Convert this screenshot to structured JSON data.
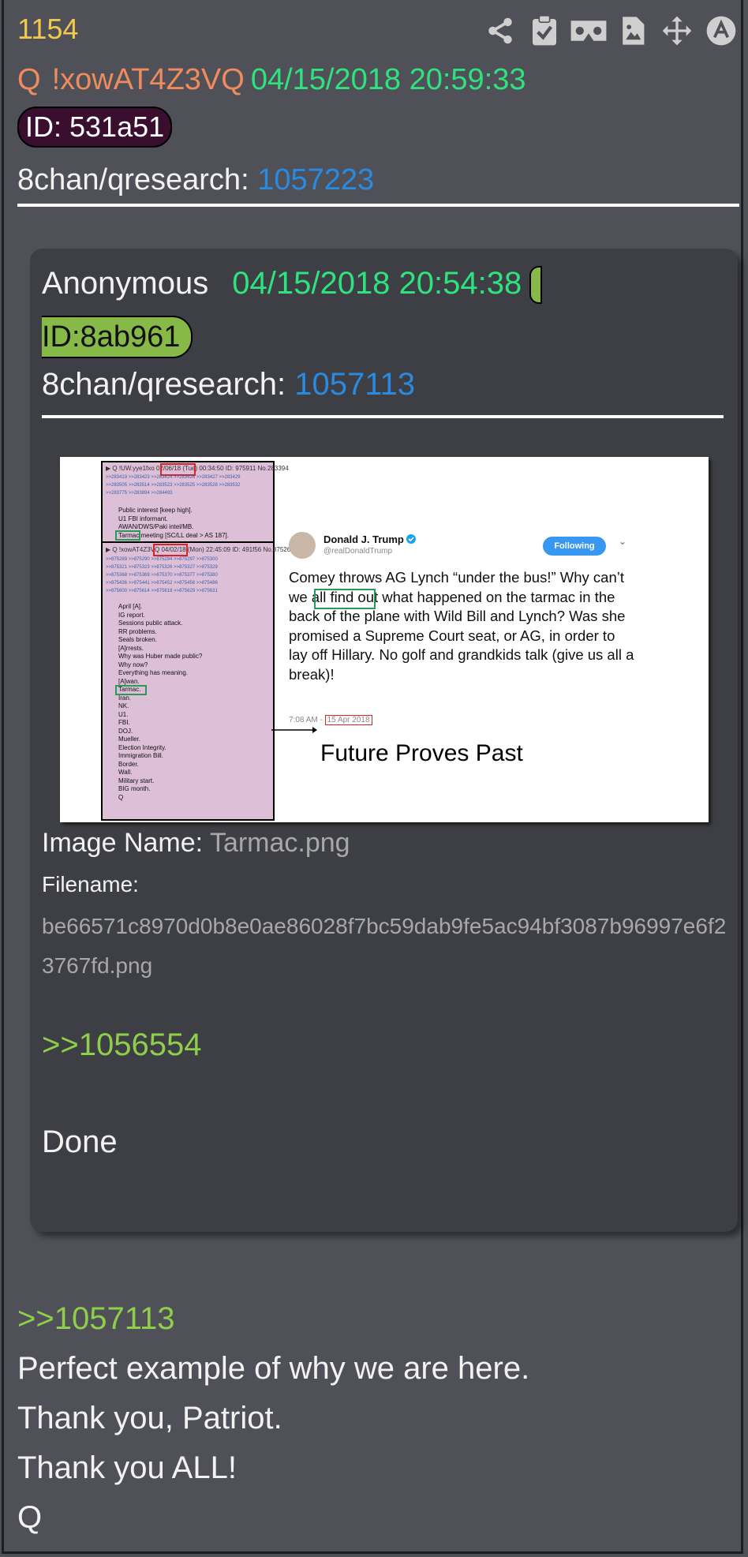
{
  "post": {
    "number": "1154",
    "author_letter": "Q",
    "tripcode": "!xowAT4Z3VQ",
    "datetime": "04/15/2018 20:59:33",
    "id_label": "ID: 531a51",
    "board": "8chan/qresearch:",
    "board_post": "1057223",
    "reply_ref": ">>1057113",
    "lines": [
      "Perfect example of why we are here.",
      "Thank you, Patriot.",
      "Thank you ALL!",
      "Q"
    ]
  },
  "toolbar_icons": [
    "share-icon",
    "clipboard-check-icon",
    "vr-goggles-icon",
    "image-file-icon",
    "move-arrows-icon",
    "circle-up-icon"
  ],
  "quoted": {
    "author": "Anonymous",
    "datetime": "04/15/2018 20:54:38",
    "id_label": "ID:8ab961",
    "board": "8chan/qresearch:",
    "board_post": "1057113",
    "image_name_label": "Image Name:",
    "image_name": "Tarmac.png",
    "filename_label": "Filename:",
    "filename": "be66571c8970d0b8e0ae86028f7bc59dab9fe5ac94bf3087b96997e6f23767fd.png",
    "reply_ref": ">>1056554",
    "text": "Done"
  },
  "screenshot": {
    "post1_header": "▶ Q !UW.yye1fxo",
    "post1_date": "02/06/18",
    "post1_meta": "(Tue) 00:34:50 ID: 975911 No.283394",
    "post1_lines": [
      "Public interest [keep high].",
      "U1 FBI informant.",
      "AWAN/DWS/Paki intel/MB.",
      "Tarmac meeting [SC/LL deal > AS 187]."
    ],
    "post2_header": "▶ Q !xowAT4Z3VQ",
    "post2_date": "04/02/18",
    "post2_meta": "(Mon) 22:45:09 ID: 491f56 No.875265",
    "post2_lines": [
      "April [A].",
      "IG report.",
      "Sessions public attack.",
      "RR problems.",
      "Seals broken.",
      "[A]rrests.",
      "Why was Huber made public?",
      "Why now?",
      "Everything has meaning.",
      "[A]wan.",
      "Tarmac.",
      "Iran.",
      "NK.",
      "U1.",
      "FBI.",
      "DOJ.",
      "Mueller.",
      "Election Integrity.",
      "Immigration Bill.",
      "Border.",
      "Wall.",
      "Military start.",
      "BIG month.",
      "Q"
    ],
    "tweet_name": "Donald J. Trump",
    "tweet_handle": "@realDonaldTrump",
    "tweet_follow": "Following",
    "tweet_text": "Comey throws AG Lynch “under the bus!” Why can’t we all find out what happened on the tarmac in the back of the plane with Wild Bill and Lynch? Was she promised a Supreme Court seat, or AG, in order to lay off Hillary. No golf and grandkids talk (give us all a break)!",
    "tweet_time": "7:08 AM -",
    "tweet_date": "15 Apr 2018",
    "caption": "Future Proves Past"
  }
}
